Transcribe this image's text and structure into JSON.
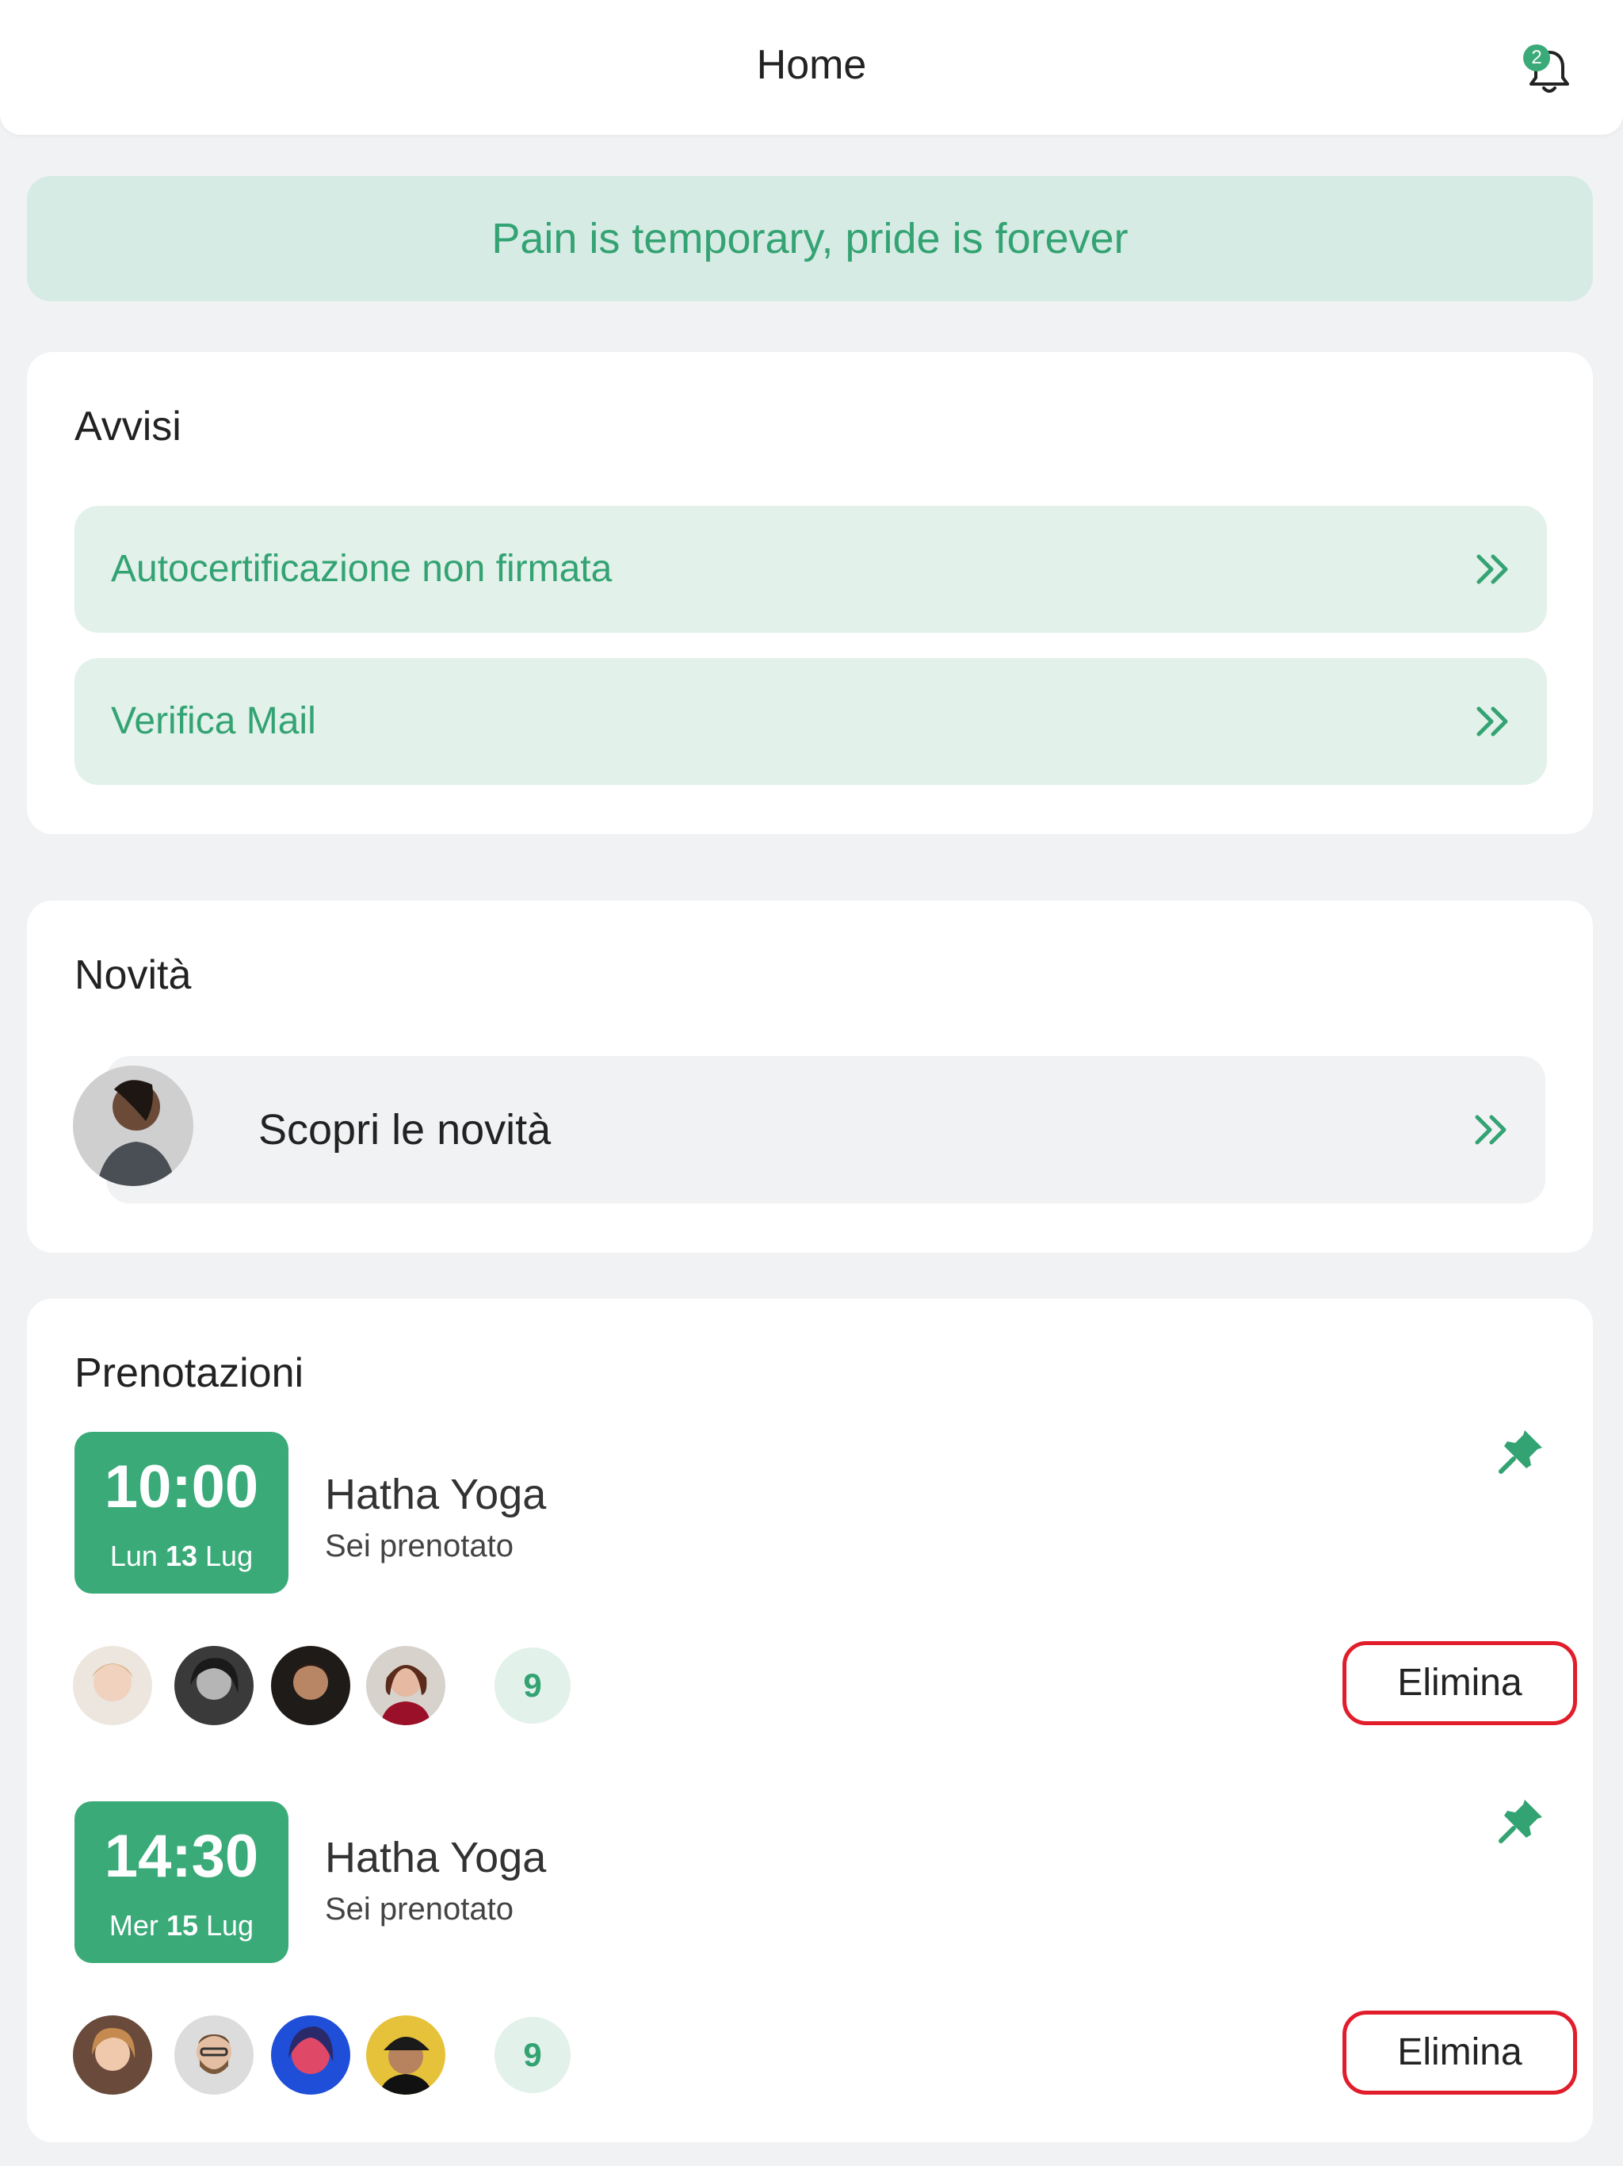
{
  "header": {
    "title": "Home",
    "notification_count": "2"
  },
  "quote": "Pain is temporary, pride is forever",
  "avvisi": {
    "title": "Avvisi",
    "items": [
      {
        "label": "Autocertificazione non firmata"
      },
      {
        "label": "Verifica Mail"
      }
    ]
  },
  "novita": {
    "title": "Novità",
    "link_label": "Scopri le novità"
  },
  "prenotazioni": {
    "title": "Prenotazioni",
    "bookings": [
      {
        "time": "10:00",
        "day": "Lun",
        "date": "13",
        "month": "Lug",
        "class_name": "Hatha Yoga",
        "status": "Sei prenotato",
        "participants_count": "9",
        "delete_label": "Elimina"
      },
      {
        "time": "14:30",
        "day": "Mer",
        "date": "15",
        "month": "Lug",
        "class_name": "Hatha Yoga",
        "status": "Sei prenotato",
        "participants_count": "9",
        "delete_label": "Elimina"
      }
    ]
  },
  "colors": {
    "accent": "#3aaa78",
    "accent_text": "#34a373",
    "accent_light": "#e2f1ea",
    "danger": "#e21d2b"
  }
}
